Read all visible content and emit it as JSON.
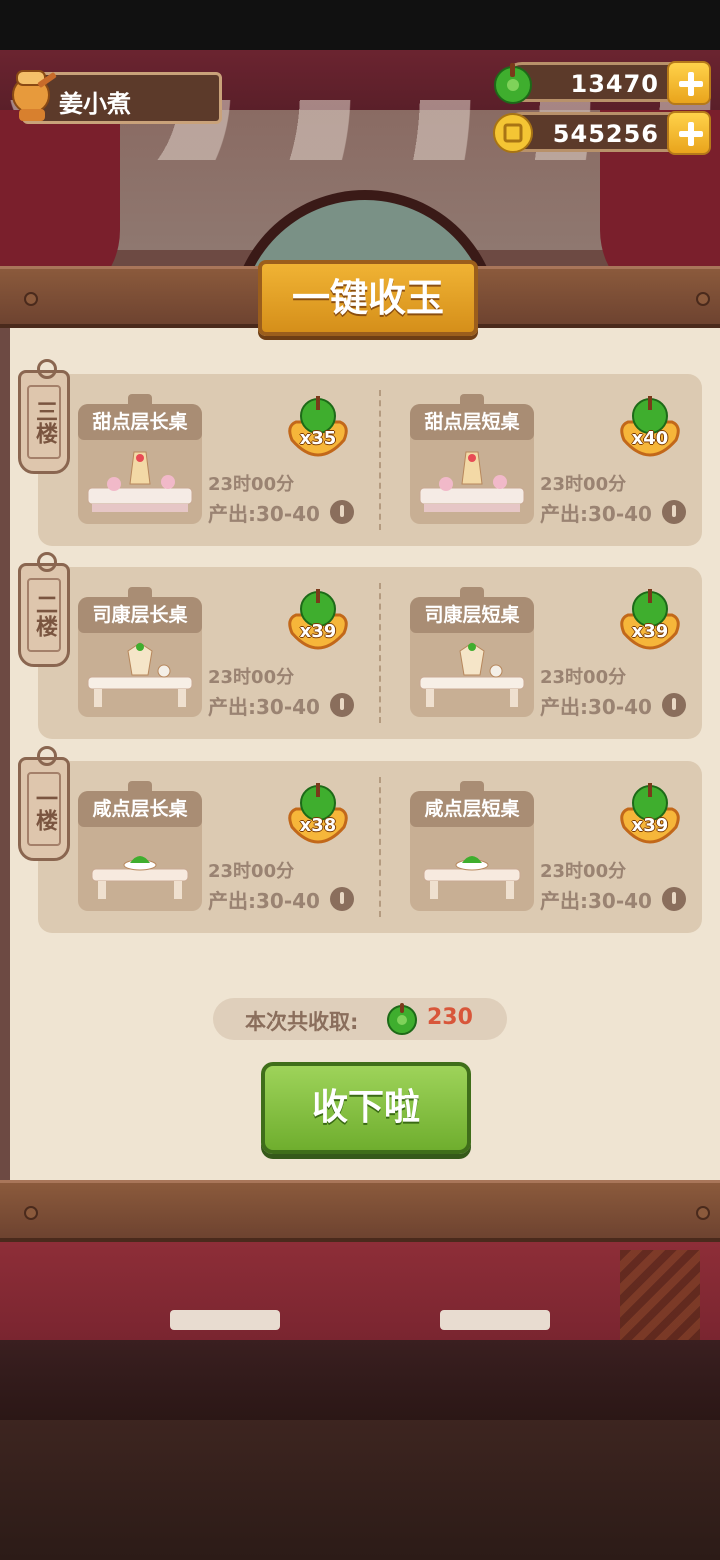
{
  "player": {
    "name": "姜小煮"
  },
  "resources": {
    "jade": "13470",
    "coins": "545256"
  },
  "panel": {
    "title": "一键收玉"
  },
  "floors": [
    {
      "label": "三楼",
      "tables": [
        {
          "name": "甜点层长桌",
          "reward": "x35",
          "time": "23时00分",
          "output": "产出:30-40"
        },
        {
          "name": "甜点层短桌",
          "reward": "x40",
          "time": "23时00分",
          "output": "产出:30-40"
        }
      ]
    },
    {
      "label": "二楼",
      "tables": [
        {
          "name": "司康层长桌",
          "reward": "x39",
          "time": "23时00分",
          "output": "产出:30-40"
        },
        {
          "name": "司康层短桌",
          "reward": "x39",
          "time": "23时00分",
          "output": "产出:30-40"
        }
      ]
    },
    {
      "label": "一楼",
      "tables": [
        {
          "name": "咸点层长桌",
          "reward": "x38",
          "time": "23时00分",
          "output": "产出:30-40"
        },
        {
          "name": "咸点层短桌",
          "reward": "x39",
          "time": "23时00分",
          "output": "产出:30-40"
        }
      ]
    }
  ],
  "summary": {
    "label": "本次共收取:",
    "total": "230"
  },
  "collect_button": {
    "label": "收下啦"
  },
  "colors": {
    "jade_green": "#3fae2e",
    "gold": "#f0b334",
    "panel_bg": "#efe4d2",
    "button_green": "#7fbf3a",
    "total_red": "#d8563a"
  }
}
